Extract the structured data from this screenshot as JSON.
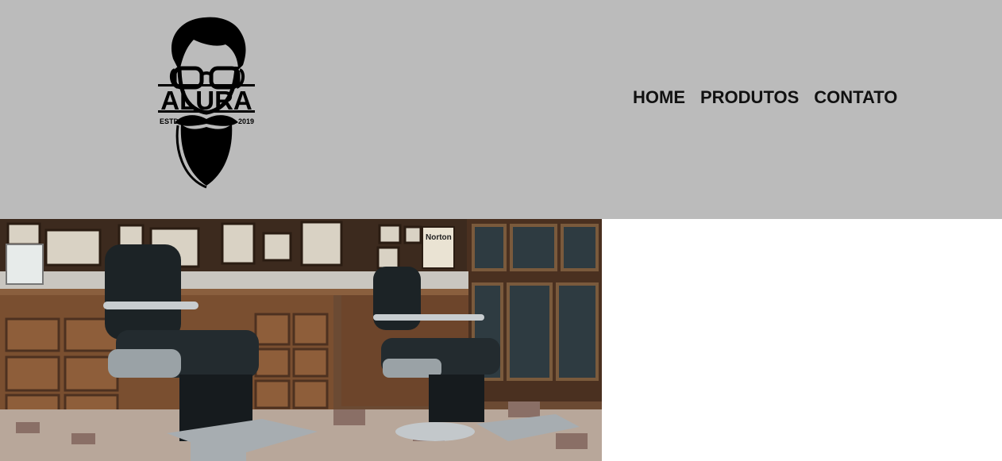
{
  "header": {
    "background": "#bbbbbb",
    "logo": {
      "brand": "ALURA",
      "estd": "ESTD",
      "year": "2019",
      "icon": "bearded-man-with-glasses-icon"
    },
    "nav": [
      {
        "label": "HOME"
      },
      {
        "label": "PRODUTOS"
      },
      {
        "label": "CONTATO"
      }
    ]
  },
  "banner": {
    "image": "barbershop-interior-photo",
    "signs": [
      "Norton"
    ]
  }
}
